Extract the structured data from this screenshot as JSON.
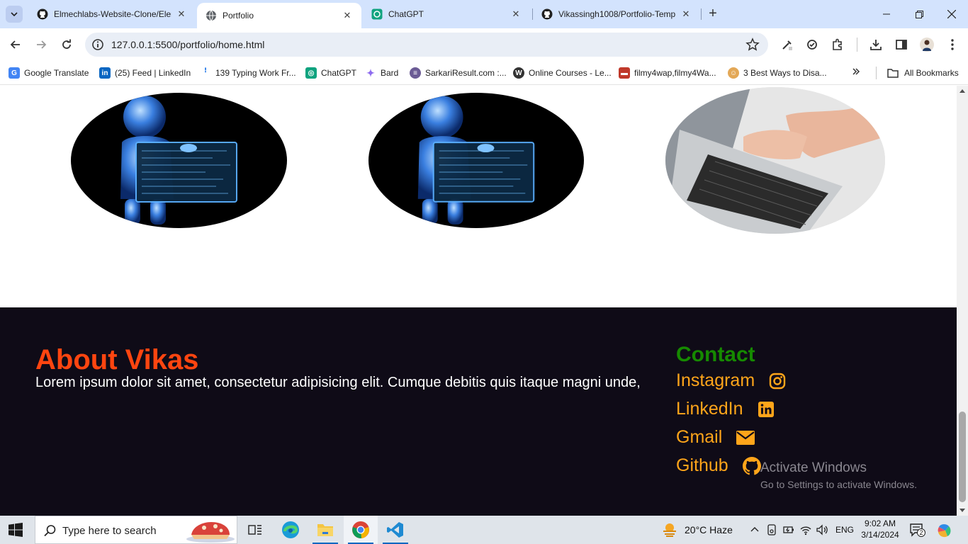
{
  "browser": {
    "tabs": [
      {
        "title": "Elmechlabs-Website-Clone/Elen",
        "icon": "github-icon",
        "active": false
      },
      {
        "title": "Portfolio",
        "icon": "globe-icon",
        "active": true
      },
      {
        "title": "ChatGPT",
        "icon": "chatgpt-icon",
        "active": false
      },
      {
        "title": "Vikassingh1008/Portfolio-Temp",
        "icon": "github-icon",
        "active": false
      }
    ],
    "address": "127.0.0.1:5500/portfolio/home.html",
    "bookmarks": [
      {
        "label": "Google Translate",
        "icon": "google-translate-icon",
        "color": "#4285f4"
      },
      {
        "label": "(25) Feed | LinkedIn",
        "icon": "linkedin-icon",
        "color": "#0a66c2"
      },
      {
        "label": "139 Typing Work Fr...",
        "icon": "typing-icon",
        "color": "#1a73e8"
      },
      {
        "label": "ChatGPT",
        "icon": "chatgpt-icon",
        "color": "#10a37f"
      },
      {
        "label": "Bard",
        "icon": "bard-icon",
        "color": "#8e6cef"
      },
      {
        "label": "SarkariResult.com :...",
        "icon": "sarkari-icon",
        "color": "#6b5b95"
      },
      {
        "label": "Online Courses - Le...",
        "icon": "courses-icon",
        "color": "#333333"
      },
      {
        "label": "filmy4wap,filmy4Wa...",
        "icon": "film-icon",
        "color": "#c0392b"
      },
      {
        "label": "3 Best Ways to Disa...",
        "icon": "avatar-icon",
        "color": "#e3a857"
      }
    ],
    "all_bookmarks_label": "All Bookmarks"
  },
  "page": {
    "footer": {
      "about_title": "About Vikas",
      "about_text": "Lorem ipsum dolor sit amet, consectetur adipisicing elit. Cumque debitis quis itaque magni unde,",
      "contact_title": "Contact",
      "links": [
        {
          "label": "Instagram",
          "icon": "instagram-icon"
        },
        {
          "label": "LinkedIn",
          "icon": "linkedin-icon"
        },
        {
          "label": "Gmail",
          "icon": "envelope-icon"
        },
        {
          "label": "Github",
          "icon": "github-icon"
        }
      ]
    },
    "images": [
      {
        "name": "robot-image-1",
        "subject": "robot holding screen"
      },
      {
        "name": "robot-image-2",
        "subject": "robot holding screen"
      },
      {
        "name": "laptop-image",
        "subject": "hands typing on laptop"
      }
    ]
  },
  "watermark": {
    "line1": "Activate Windows",
    "line2": "Go to Settings to activate Windows."
  },
  "taskbar": {
    "search_placeholder": "Type here to search",
    "weather": "20°C  Haze",
    "language": "ENG",
    "time": "9:02 AM",
    "date": "3/14/2024",
    "notification_count": "2"
  },
  "colors": {
    "about_title": "#ff4510",
    "contact_title": "#168a00",
    "contact_links": "#ffa51a",
    "footer_bg": "#0f0b17",
    "tab_strip": "#d3e3fd"
  }
}
